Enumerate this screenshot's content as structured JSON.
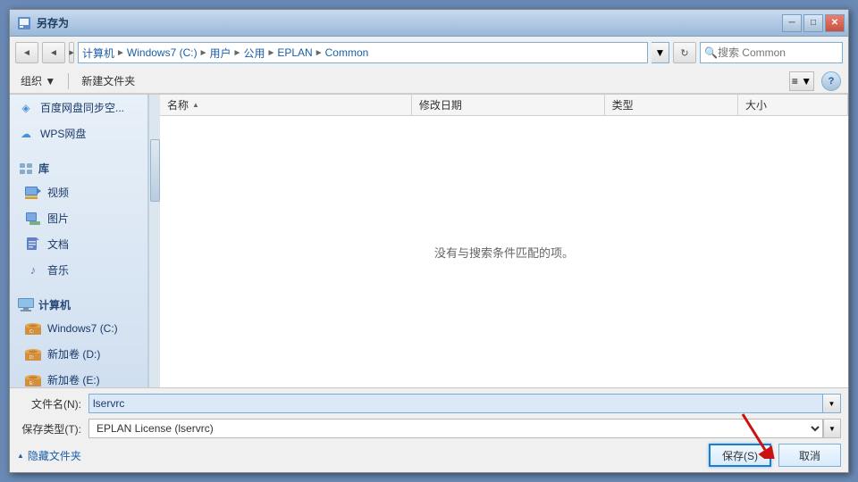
{
  "dialog": {
    "title": "另存为",
    "close_label": "✕",
    "minimize_label": "─",
    "maximize_label": "□"
  },
  "nav": {
    "back_label": "◄",
    "forward_label": "►",
    "up_label": "▲",
    "address_dropdown_label": "▼",
    "search_placeholder": "搜索 Common",
    "search_icon": "🔍"
  },
  "breadcrumbs": [
    {
      "label": "计算机",
      "sep": "►"
    },
    {
      "label": "Windows7 (C:)",
      "sep": "►"
    },
    {
      "label": "用户",
      "sep": "►"
    },
    {
      "label": "公用",
      "sep": "►"
    },
    {
      "label": "EPLAN",
      "sep": "►"
    },
    {
      "label": "Common",
      "sep": ""
    }
  ],
  "toolbar": {
    "organize_label": "组织 ▼",
    "new_folder_label": "新建文件夹",
    "view_icon": "≡",
    "help_label": "?"
  },
  "sidebar": {
    "items": [
      {
        "type": "cloud",
        "label": "百度网盘同步空...",
        "icon": "◈"
      },
      {
        "type": "cloud",
        "label": "WPS网盘",
        "icon": "☁"
      },
      {
        "type": "section",
        "label": "库"
      },
      {
        "type": "folder",
        "label": "视频",
        "icon": "▣"
      },
      {
        "type": "folder",
        "label": "图片",
        "icon": "▣"
      },
      {
        "type": "folder",
        "label": "文档",
        "icon": "▣"
      },
      {
        "type": "folder",
        "label": "音乐",
        "icon": "♪"
      },
      {
        "type": "section",
        "label": "计算机"
      },
      {
        "type": "drive",
        "label": "Windows7 (C:)",
        "icon": "💾"
      },
      {
        "type": "drive",
        "label": "新加卷 (D:)",
        "icon": "💾"
      },
      {
        "type": "drive",
        "label": "新加卷 (E:)",
        "icon": "💾"
      }
    ]
  },
  "file_list": {
    "columns": [
      {
        "label": "名称",
        "sort_arrow": "▲"
      },
      {
        "label": "修改日期"
      },
      {
        "label": "类型"
      },
      {
        "label": "大小"
      }
    ],
    "empty_message": "没有与搜索条件匹配的项。"
  },
  "form": {
    "filename_label": "文件名(N):",
    "filename_value": "lservrc",
    "filetype_label": "保存类型(T):",
    "filetype_value": "EPLAN License (lservrc)"
  },
  "buttons": {
    "hide_folders_label": "隐藏文件夹",
    "save_label": "保存(S)",
    "cancel_label": "取消"
  },
  "colors": {
    "accent": "#1a7fd4",
    "title_bg_start": "#c8daf0",
    "title_bg_end": "#9ab8d8"
  }
}
